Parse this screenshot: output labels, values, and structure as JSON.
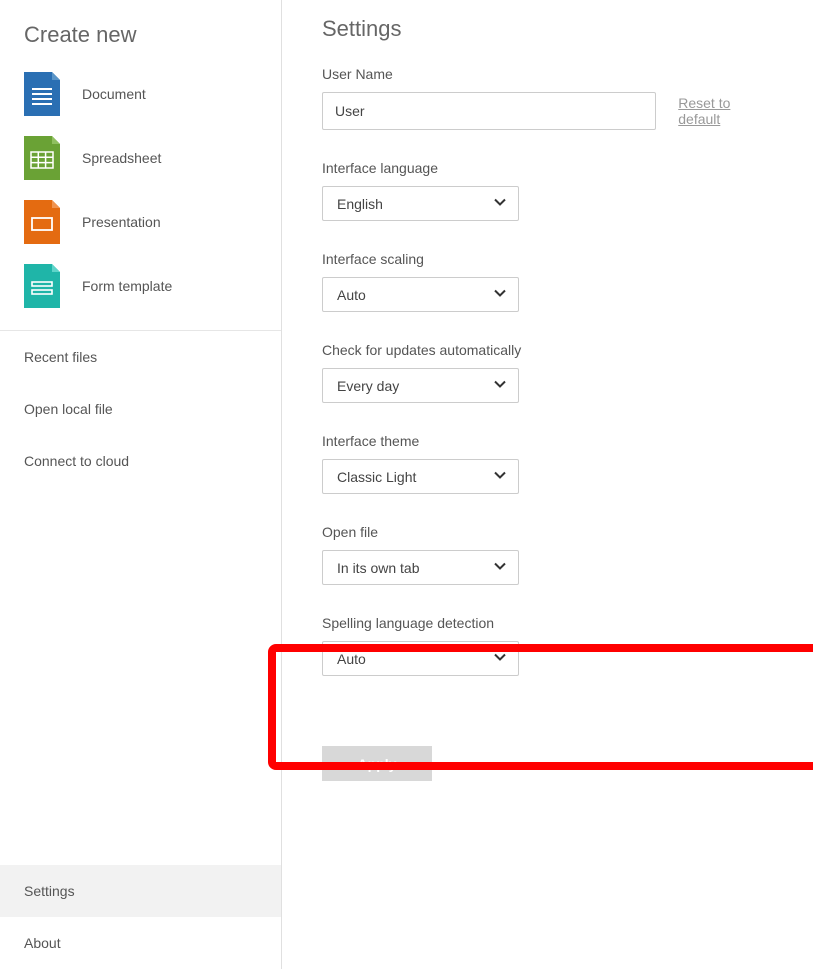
{
  "sidebar": {
    "heading": "Create new",
    "create_items": [
      {
        "label": "Document"
      },
      {
        "label": "Spreadsheet"
      },
      {
        "label": "Presentation"
      },
      {
        "label": "Form template"
      }
    ],
    "links": [
      {
        "label": "Recent files"
      },
      {
        "label": "Open local file"
      },
      {
        "label": "Connect to cloud"
      }
    ],
    "footer": {
      "settings": "Settings",
      "about": "About"
    }
  },
  "main": {
    "title": "Settings",
    "username": {
      "label": "User Name",
      "value": "User",
      "reset": "Reset to default"
    },
    "language": {
      "label": "Interface language",
      "value": "English"
    },
    "scaling": {
      "label": "Interface scaling",
      "value": "Auto"
    },
    "updates": {
      "label": "Check for updates automatically",
      "value": "Every day"
    },
    "theme": {
      "label": "Interface theme",
      "value": "Classic Light"
    },
    "openfile": {
      "label": "Open file",
      "value": "In its own tab"
    },
    "spelling": {
      "label": "Spelling language detection",
      "value": "Auto"
    },
    "apply": "Apply"
  }
}
